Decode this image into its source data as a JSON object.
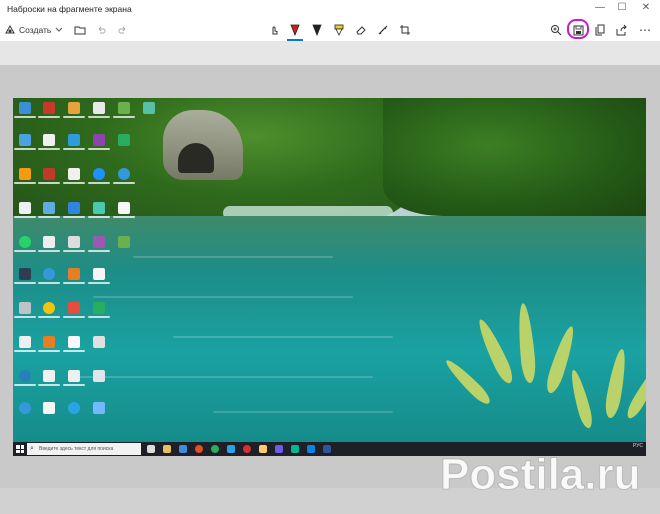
{
  "window": {
    "title": "Наброски на фрагменте экрана",
    "minimize_glyph": "—",
    "maximize_glyph": "☐",
    "close_glyph": "✕"
  },
  "toolbar": {
    "new_label": "Создать",
    "tools": [
      {
        "name": "touch-writing-icon",
        "glyph": "☜"
      },
      {
        "name": "ballpoint-pen-icon",
        "glyph": "▼",
        "color": "#d01d1d",
        "selected": true
      },
      {
        "name": "pencil-icon",
        "glyph": "▼",
        "color": "#222222"
      },
      {
        "name": "highlighter-icon",
        "glyph": "▼",
        "color": "#e8d21a"
      },
      {
        "name": "eraser-icon",
        "glyph": "⌫"
      },
      {
        "name": "ruler-icon",
        "glyph": "✎"
      },
      {
        "name": "crop-icon",
        "glyph": "⌗"
      }
    ],
    "right": [
      {
        "name": "zoom-icon",
        "glyph": "⊕"
      },
      {
        "name": "save-icon",
        "glyph": "💾"
      },
      {
        "name": "copy-icon",
        "glyph": "⧉"
      },
      {
        "name": "share-icon",
        "glyph": "⇪"
      },
      {
        "name": "more-icon",
        "glyph": "⋯"
      }
    ]
  },
  "screenshot": {
    "taskbar_search_placeholder": "Введите здесь текст для поиска",
    "tray_lang": "РУС"
  },
  "colors": {
    "highlight": "#c01ec6",
    "accent": "#0078d7"
  },
  "watermark": {
    "text": "Postila.ru"
  }
}
